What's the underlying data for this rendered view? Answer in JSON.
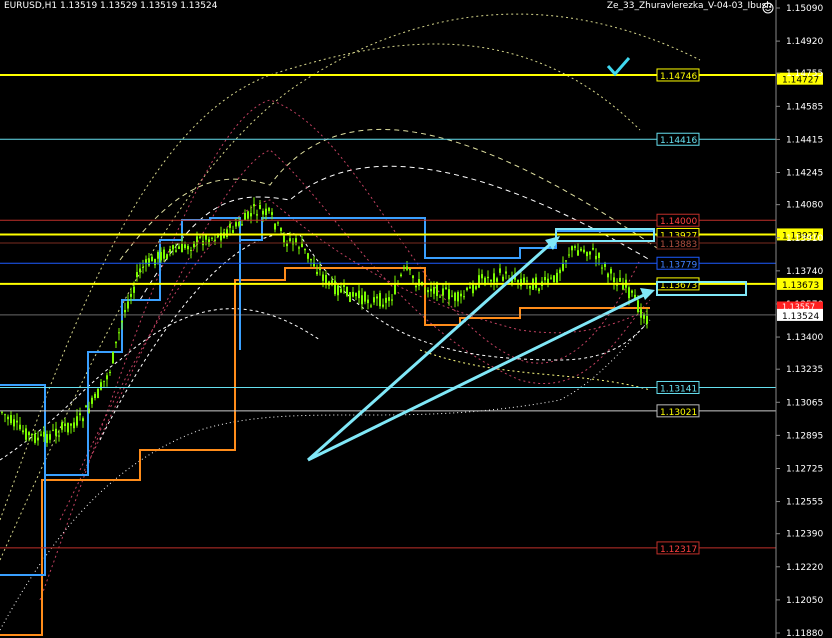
{
  "header": {
    "symbol_info": "EURUSD,H1  1.13519 1.13529 1.13519 1.13524",
    "ea_name": "Ze_33_Zhuravlerezka_V-04-03_Ibush",
    "smiley_icon": "smiley-icon"
  },
  "colors": {
    "background": "#000000",
    "candle": "#7CFC00",
    "yellow_line": "#FFFF00",
    "cyan": "#66E0F0",
    "red": "#C0302A",
    "blue": "#1E5CFF",
    "orange": "#FF8C1A",
    "grid": "#333333"
  },
  "price_axis": {
    "ticks": [
      "1.15090",
      "1.14920",
      "1.14755",
      "1.14585",
      "1.14415",
      "1.14245",
      "1.14080",
      "1.13910",
      "1.13740",
      "1.13570",
      "1.13400",
      "1.13235",
      "1.13065",
      "1.12895",
      "1.12725",
      "1.12555",
      "1.12390",
      "1.12220",
      "1.12050",
      "1.11880"
    ],
    "current_price": "1.13524",
    "current_marker": "1.13557",
    "bid_marker": "1.13524"
  },
  "levels": [
    {
      "label": "1.14746",
      "axis": "1.14727",
      "style": "yellow"
    },
    {
      "label": "1.14416",
      "style": "cyan"
    },
    {
      "label": "1.14000",
      "style": "red"
    },
    {
      "label": "1.13927",
      "axis": "1.13927",
      "style": "yellow"
    },
    {
      "label": "1.13883",
      "style": "darkred"
    },
    {
      "label": "1.13779",
      "style": "blue"
    },
    {
      "label": "1.13673",
      "axis": "1.13673",
      "style": "yellow"
    },
    {
      "label": "1.13141",
      "style": "cyan"
    },
    {
      "label": "1.13021",
      "style": "white"
    },
    {
      "label": "1.12317",
      "style": "red"
    }
  ],
  "annotations": {
    "checkmark": "check-icon",
    "arrows": 2,
    "target_boxes": 2
  }
}
